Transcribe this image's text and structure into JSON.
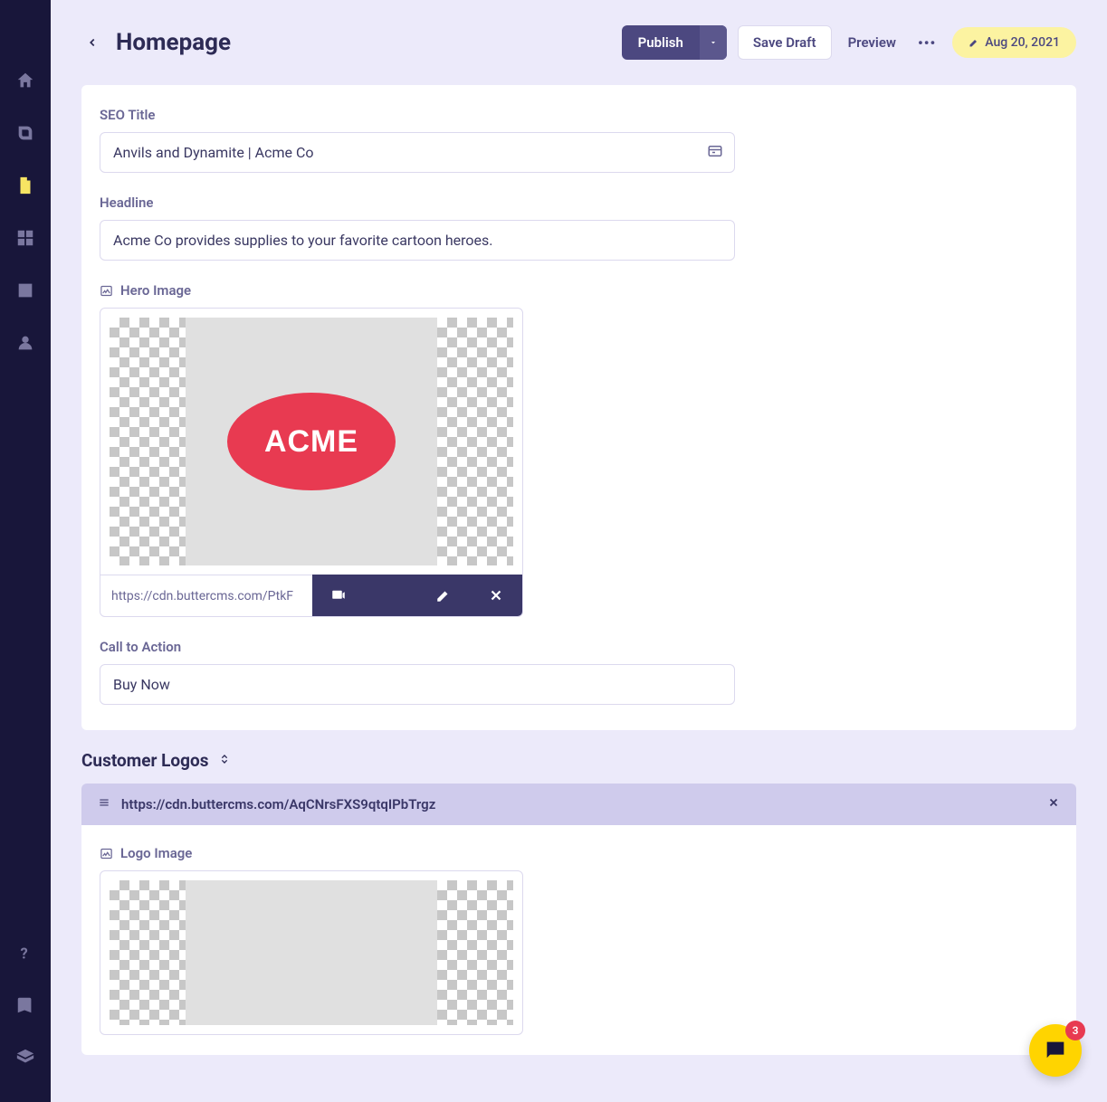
{
  "header": {
    "title": "Homepage",
    "publish_label": "Publish",
    "save_draft_label": "Save Draft",
    "preview_label": "Preview",
    "date_label": "Aug 20, 2021"
  },
  "sidebar": {
    "items": [
      {
        "icon": "home-icon"
      },
      {
        "icon": "blog-icon"
      },
      {
        "icon": "page-icon",
        "active": true
      },
      {
        "icon": "grid-icon"
      },
      {
        "icon": "image-icon"
      },
      {
        "icon": "users-icon"
      }
    ],
    "bottom": [
      {
        "icon": "help-icon"
      },
      {
        "icon": "book-icon"
      },
      {
        "icon": "stack-icon"
      }
    ]
  },
  "fields": {
    "seo_title": {
      "label": "SEO Title",
      "value": "Anvils and Dynamite | Acme Co"
    },
    "headline": {
      "label": "Headline",
      "value": "Acme Co provides supplies to your favorite cartoon heroes."
    },
    "hero_image": {
      "label": "Hero Image",
      "url": "https://cdn.buttercms.com/PtkF",
      "logo_text": "ACME"
    },
    "cta": {
      "label": "Call to Action",
      "value": "Buy Now"
    }
  },
  "customer_logos": {
    "section_label": "Customer Logos",
    "items": [
      {
        "url": "https://cdn.buttercms.com/AqCNrsFXS9qtqIPbTrgz",
        "logo_label": "Logo Image"
      }
    ]
  },
  "chat": {
    "badge_count": "3"
  }
}
